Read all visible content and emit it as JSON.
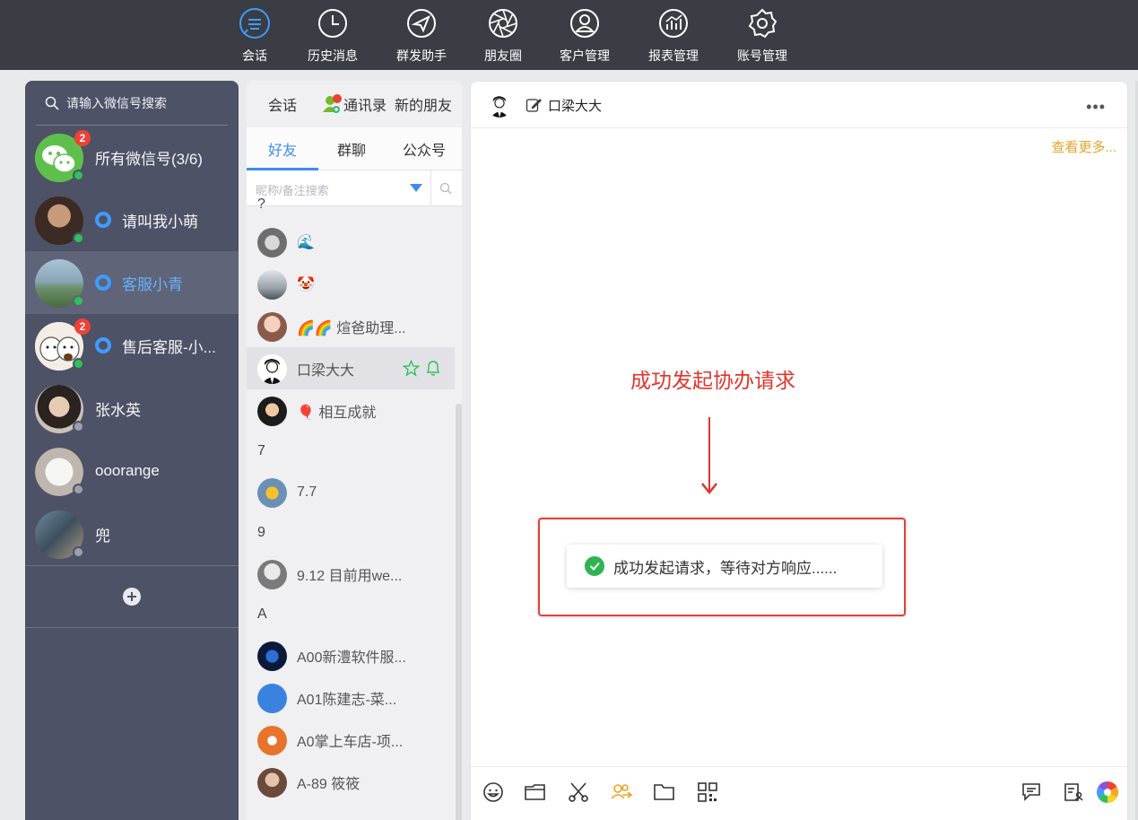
{
  "nav": {
    "items": [
      {
        "label": "会话",
        "icon": "chat-icon"
      },
      {
        "label": "历史消息",
        "icon": "clock-icon"
      },
      {
        "label": "群发助手",
        "icon": "send-icon"
      },
      {
        "label": "朋友圈",
        "icon": "aperture-icon"
      },
      {
        "label": "客户管理",
        "icon": "customer-icon"
      },
      {
        "label": "报表管理",
        "icon": "chart-icon"
      },
      {
        "label": "账号管理",
        "icon": "gear-icon"
      }
    ],
    "active": "会话",
    "accent": "#3f9cff"
  },
  "accounts": {
    "search_placeholder": "请输入微信号搜索",
    "items": [
      {
        "name": "所有微信号(3/6)",
        "badge": "2",
        "status": "online"
      },
      {
        "name": "请叫我小萌",
        "status": "online"
      },
      {
        "name": "客服小青",
        "status": "online",
        "selected": true
      },
      {
        "name": "售后客服-小...",
        "badge": "2",
        "status": "online"
      },
      {
        "name": "张水英",
        "status": "offline"
      },
      {
        "name": "ooorange",
        "status": "offline"
      },
      {
        "name": "兜",
        "status": "offline"
      }
    ]
  },
  "contacts": {
    "tabs": [
      "会话",
      "通讯录",
      "新的朋友"
    ],
    "subtabs": [
      "好友",
      "群聊",
      "公众号"
    ],
    "active_subtab": "好友",
    "filter_placeholder": "昵称/备注搜索",
    "groups": [
      {
        "letter": "?",
        "items": [
          {
            "name": "🌊"
          },
          {
            "name": "🤡"
          },
          {
            "name": "🌈🌈 煊爸助理..."
          },
          {
            "name": "口梁大大",
            "selected": true
          },
          {
            "name": "🎈 相互成就"
          }
        ]
      },
      {
        "letter": "7",
        "items": [
          {
            "name": "7.7"
          }
        ]
      },
      {
        "letter": "9",
        "items": [
          {
            "name": "9.12 目前用we..."
          }
        ]
      },
      {
        "letter": "A",
        "items": [
          {
            "name": "A00新澧软件服..."
          },
          {
            "name": "A01陈建志-菜..."
          },
          {
            "name": "A0掌上车店-项..."
          },
          {
            "name": "A-89 筱筱"
          }
        ]
      }
    ]
  },
  "chat": {
    "title": "口梁大大",
    "see_more": "查看更多...",
    "annotation": "成功发起协办请求",
    "toast": "成功发起请求，等待对方响应......",
    "toolbar_icons": [
      "emoji-icon",
      "folder-icon",
      "scissors-icon",
      "group-assist-icon",
      "file-icon",
      "qrcode-icon",
      "message-icon",
      "card-icon",
      "colorwheel-icon"
    ]
  }
}
